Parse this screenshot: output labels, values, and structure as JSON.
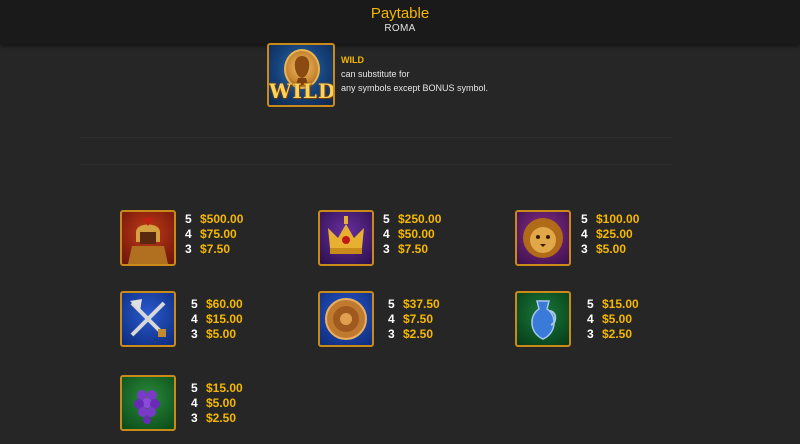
{
  "header": {
    "title": "Paytable",
    "subtitle": "ROMA"
  },
  "wild": {
    "icon_label": "WILD",
    "name": "WILD",
    "line1": "can substitute for",
    "line2": "any symbols except BONUS symbol."
  },
  "symbols": [
    {
      "icon": "gladiator-icon",
      "bg": "#8a2010",
      "pays": [
        {
          "n": "5",
          "v": "$500.00"
        },
        {
          "n": "4",
          "v": "$75.00"
        },
        {
          "n": "3",
          "v": "$7.50"
        }
      ]
    },
    {
      "icon": "crown-icon",
      "bg": "#4a1f7a",
      "pays": [
        {
          "n": "5",
          "v": "$250.00"
        },
        {
          "n": "4",
          "v": "$50.00"
        },
        {
          "n": "3",
          "v": "$7.50"
        }
      ]
    },
    {
      "icon": "lion-icon",
      "bg": "#6a1f6e",
      "pays": [
        {
          "n": "5",
          "v": "$100.00"
        },
        {
          "n": "4",
          "v": "$25.00"
        },
        {
          "n": "3",
          "v": "$5.00"
        }
      ]
    },
    {
      "icon": "crossed-weapons-icon",
      "bg": "#143f9a",
      "pays": [
        {
          "n": "5",
          "v": "$60.00"
        },
        {
          "n": "4",
          "v": "$15.00"
        },
        {
          "n": "3",
          "v": "$5.00"
        }
      ]
    },
    {
      "icon": "shield-icon",
      "bg": "#1a3fa0",
      "pays": [
        {
          "n": "5",
          "v": "$37.50"
        },
        {
          "n": "4",
          "v": "$7.50"
        },
        {
          "n": "3",
          "v": "$2.50"
        }
      ]
    },
    {
      "icon": "vase-icon",
      "bg": "#0f5a2a",
      "pays": [
        {
          "n": "5",
          "v": "$15.00"
        },
        {
          "n": "4",
          "v": "$5.00"
        },
        {
          "n": "3",
          "v": "$2.50"
        }
      ]
    },
    {
      "icon": "grapes-icon",
      "bg": "#1f6a2a",
      "pays": [
        {
          "n": "5",
          "v": "$15.00"
        },
        {
          "n": "4",
          "v": "$5.00"
        },
        {
          "n": "3",
          "v": "$2.50"
        }
      ]
    }
  ]
}
